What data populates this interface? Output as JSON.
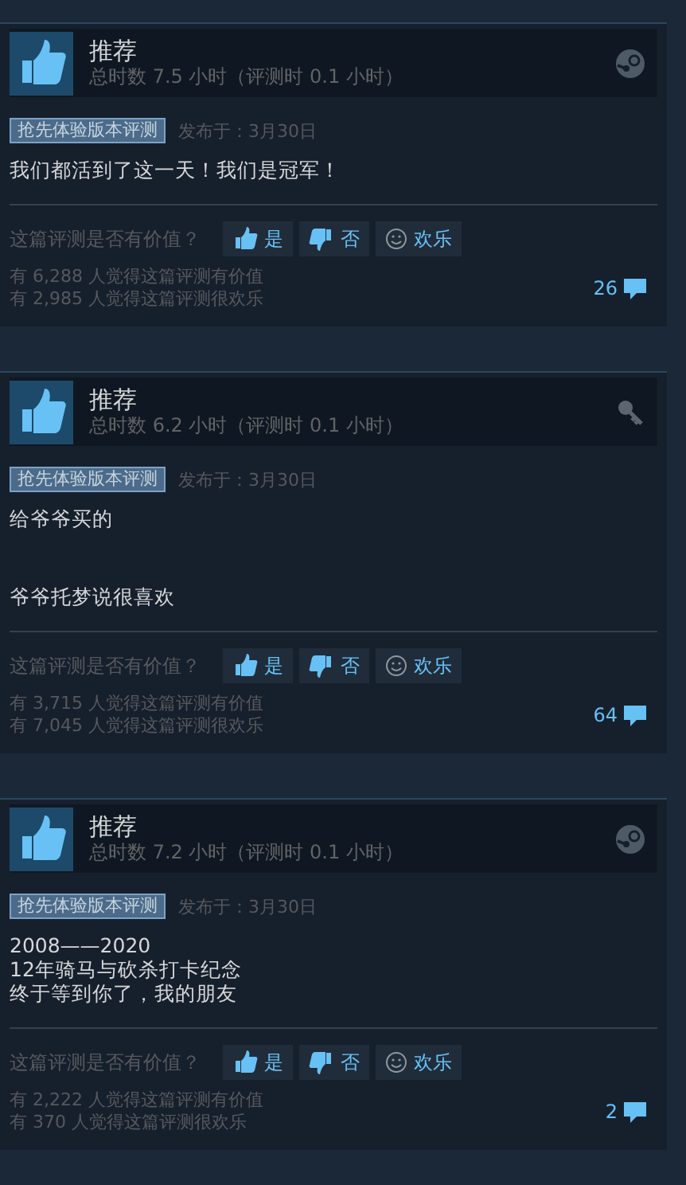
{
  "reviews": [
    {
      "verdict": "推荐",
      "recommended": true,
      "hours": "总时数 7.5 小时（评测时 0.1 小时）",
      "kind": "steam",
      "tag": "抢先体验版本评测",
      "posted": "发布于：3月30日",
      "paragraphs": [
        [
          "我们都活到了这一天！我们是冠军！"
        ]
      ],
      "question": "这篇评测是否有价值？",
      "buttons": [
        {
          "kind": "up",
          "label": "是"
        },
        {
          "kind": "down",
          "label": "否"
        },
        {
          "kind": "funny",
          "label": "欢乐"
        }
      ],
      "helpful": "有 6,288 人觉得这篇评测有价值",
      "funny": "有 2,985 人觉得这篇评测很欢乐",
      "comments": "26"
    },
    {
      "verdict": "推荐",
      "recommended": true,
      "hours": "总时数 6.2 小时（评测时 0.1 小时）",
      "kind": "key",
      "tag": "抢先体验版本评测",
      "posted": "发布于：3月30日",
      "paragraphs": [
        [
          "给爷爷买的"
        ],
        [
          "爷爷托梦说很喜欢"
        ]
      ],
      "question": "这篇评测是否有价值？",
      "buttons": [
        {
          "kind": "up",
          "label": "是"
        },
        {
          "kind": "down",
          "label": "否"
        },
        {
          "kind": "funny",
          "label": "欢乐"
        }
      ],
      "helpful": "有 3,715 人觉得这篇评测有价值",
      "funny": "有 7,045 人觉得这篇评测很欢乐",
      "comments": "64"
    },
    {
      "verdict": "推荐",
      "recommended": true,
      "hours": "总时数 7.2 小时（评测时 0.1 小时）",
      "kind": "steam",
      "tag": "抢先体验版本评测",
      "posted": "发布于：3月30日",
      "paragraphs": [
        [
          "2008——2020",
          "12年骑马与砍杀打卡纪念",
          "终于等到你了，我的朋友"
        ]
      ],
      "question": "这篇评测是否有价值？",
      "buttons": [
        {
          "kind": "up",
          "label": "是"
        },
        {
          "kind": "down",
          "label": "否"
        },
        {
          "kind": "funny",
          "label": "欢乐"
        }
      ],
      "helpful": "有 2,222 人觉得这篇评测有价值",
      "funny": "有 370 人觉得这篇评测很欢乐",
      "comments": "2"
    }
  ]
}
